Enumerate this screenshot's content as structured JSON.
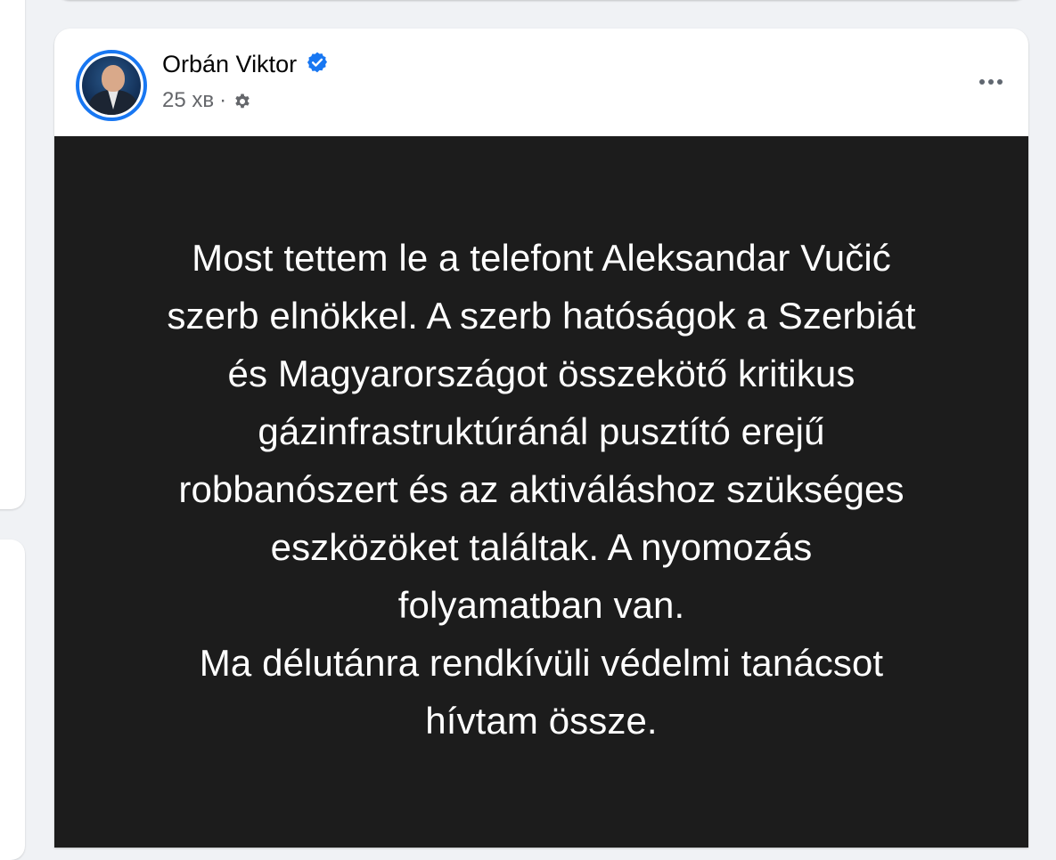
{
  "post": {
    "author": "Orbán Viktor",
    "verified": true,
    "time": "25 хв",
    "separator": "·",
    "audience_icon": "settings-gear-icon",
    "more_icon": "more-options-icon",
    "text_lines": [
      "Most tettem le a telefont Aleksandar Vučić",
      "szerb elnökkel. A szerb hatóságok a Szerbiát",
      "és Magyarországot összekötő kritikus",
      "gázinfrastruktúránál pusztító erejű",
      "robbanószert és az aktiváláshoz szükséges",
      "eszközöket találtak. A nyomozás",
      "folyamatban van.",
      "Ma délutánra rendkívüli védelmi tanácsot",
      "hívtam össze."
    ],
    "background_color": "#1c1c1c",
    "text_color": "#ffffff"
  },
  "colors": {
    "accent": "#1877f2",
    "page_bg": "#f0f2f5",
    "meta_text": "#65676b"
  }
}
